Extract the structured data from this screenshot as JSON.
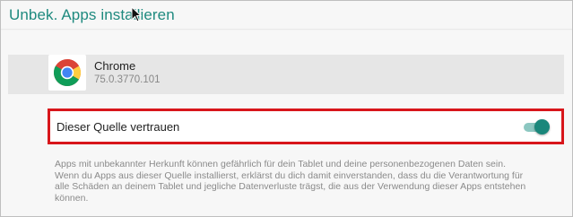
{
  "header": {
    "title": "Unbek. Apps installieren"
  },
  "app": {
    "name": "Chrome",
    "version": "75.0.3770.101",
    "icon": "chrome-icon"
  },
  "trust": {
    "label": "Dieser Quelle vertrauen",
    "enabled": true,
    "toggle_color": "#1a877b",
    "highlight_color": "#d8161b"
  },
  "description": {
    "lines": [
      "Apps mit unbekannter Herkunft können gefährlich für dein Tablet und deine personenbezogenen Daten sein.",
      "Wenn du Apps aus dieser Quelle installierst, erklärst du dich damit einverstanden, dass du die Verantwortung für",
      "alle Schäden an deinem Tablet und jegliche Datenverluste trägst, die aus der Verwendung dieser Apps entstehen",
      "können."
    ]
  },
  "colors": {
    "accent": "#1f8a7f"
  }
}
